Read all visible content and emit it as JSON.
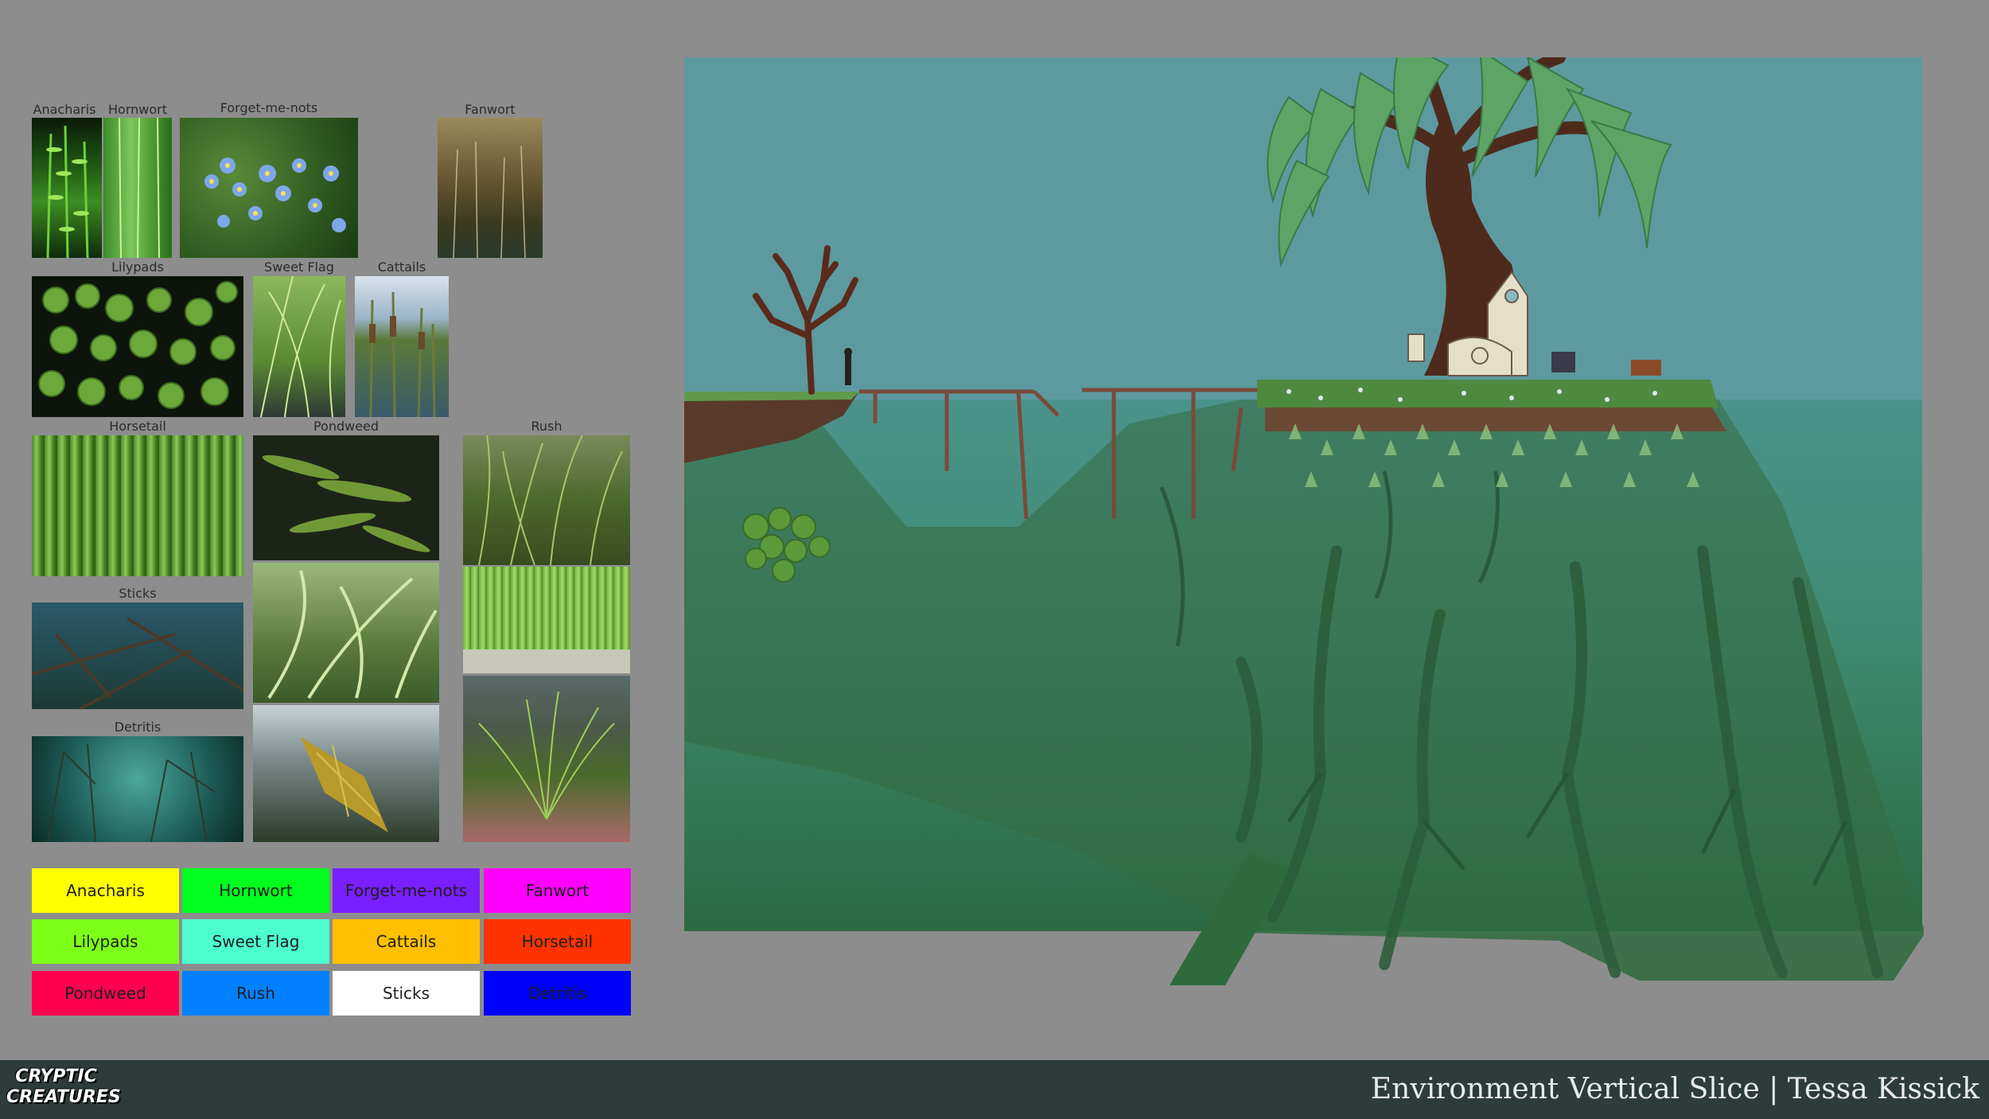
{
  "references": [
    {
      "id": "anacharis",
      "label": "Anacharis"
    },
    {
      "id": "hornwort",
      "label": "Hornwort"
    },
    {
      "id": "forget",
      "label": "Forget-me-nots"
    },
    {
      "id": "fanwort",
      "label": "Fanwort"
    },
    {
      "id": "lilypads",
      "label": "Lilypads"
    },
    {
      "id": "sweetflag",
      "label": "Sweet Flag"
    },
    {
      "id": "cattails",
      "label": "Cattails"
    },
    {
      "id": "horsetail",
      "label": "Horsetail"
    },
    {
      "id": "pondweed",
      "label": "Pondweed"
    },
    {
      "id": "rush",
      "label": "Rush"
    },
    {
      "id": "sticks",
      "label": "Sticks"
    },
    {
      "id": "detritis",
      "label": "Detritis"
    }
  ],
  "legend": [
    {
      "label": "Anacharis",
      "color": "#ffff00"
    },
    {
      "label": "Hornwort",
      "color": "#00ff1e"
    },
    {
      "label": "Forget-me-nots",
      "color": "#7a1fff"
    },
    {
      "label": "Fanwort",
      "color": "#ff00ff"
    },
    {
      "label": "Lilypads",
      "color": "#7dff1a"
    },
    {
      "label": "Sweet Flag",
      "color": "#4dffcf"
    },
    {
      "label": "Cattails",
      "color": "#ffc000"
    },
    {
      "label": "Horsetail",
      "color": "#ff3300"
    },
    {
      "label": "Pondweed",
      "color": "#ff0050"
    },
    {
      "label": "Rush",
      "color": "#0080ff"
    },
    {
      "label": "Sticks",
      "color": "#ffffff"
    },
    {
      "label": "Detritis",
      "color": "#0000ff"
    }
  ],
  "logo": {
    "line1": "CRYPTIC",
    "line2": "CREATURES"
  },
  "footer": {
    "title": "Environment Vertical Slice | Tessa Kissick"
  },
  "colors": {
    "background": "#8d8d8d",
    "footer": "#2e3b3b",
    "sky": "#5c9aa0",
    "water": "#3f8a74",
    "deep": "#2c6a44"
  }
}
